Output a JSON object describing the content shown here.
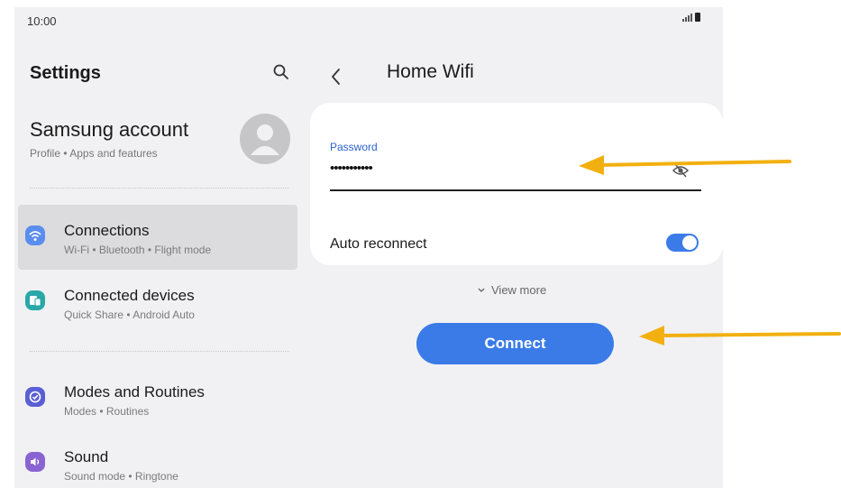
{
  "status_bar": {
    "time": "10:00"
  },
  "left_pane": {
    "title": "Settings",
    "account": {
      "name": "Samsung account",
      "subtitle": "Profile • Apps and features"
    },
    "items": [
      {
        "title": "Connections",
        "subtitle": "Wi-Fi • Bluetooth • Flight mode",
        "icon": "wifi-icon",
        "color": "#5b8def",
        "selected": true
      },
      {
        "title": "Connected devices",
        "subtitle": "Quick Share • Android Auto",
        "icon": "devices-icon",
        "color": "#2aa8a8",
        "selected": false
      },
      {
        "title": "Modes and Routines",
        "subtitle": "Modes • Routines",
        "icon": "check-circle-icon",
        "color": "#5a5fd6",
        "selected": false
      },
      {
        "title": "Sound",
        "subtitle": "Sound mode • Ringtone",
        "icon": "speaker-icon",
        "color": "#8a63d2",
        "selected": false
      }
    ]
  },
  "right_pane": {
    "title": "Home Wifi",
    "password": {
      "label": "Password",
      "value": "•••••••••••"
    },
    "auto_reconnect": {
      "label": "Auto reconnect",
      "on": true
    },
    "view_more": "View more",
    "connect_label": "Connect"
  },
  "colors": {
    "accent": "#3b7be8",
    "annotation_arrow": "#f2b010",
    "selected_row": "#dcdcde"
  }
}
